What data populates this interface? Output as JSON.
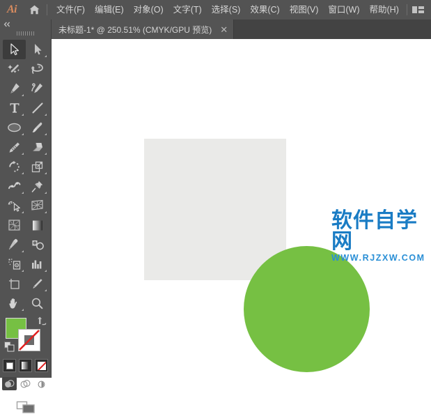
{
  "app": {
    "name": "Adobe Illustrator",
    "logo_text": "Ai"
  },
  "menubar": {
    "home_icon": "home-icon",
    "workspace_icon": "workspace-layout-icon",
    "items": [
      {
        "label": "文件(F)",
        "name": "menu-file"
      },
      {
        "label": "编辑(E)",
        "name": "menu-edit"
      },
      {
        "label": "对象(O)",
        "name": "menu-object"
      },
      {
        "label": "文字(T)",
        "name": "menu-type"
      },
      {
        "label": "选择(S)",
        "name": "menu-select"
      },
      {
        "label": "效果(C)",
        "name": "menu-effect"
      },
      {
        "label": "视图(V)",
        "name": "menu-view"
      },
      {
        "label": "窗口(W)",
        "name": "menu-window"
      },
      {
        "label": "帮助(H)",
        "name": "menu-help"
      }
    ]
  },
  "tabbar": {
    "document_title": "未标题-1* @ 250.51% (CMYK/GPU 预览)",
    "close_label": "✕"
  },
  "toolbar": {
    "collapse_icon": "double-chevron-left-icon",
    "grip_icon": "drag-grip-icon",
    "tools": [
      {
        "name": "tool-selection",
        "icon": "arrow-cursor-icon",
        "active": true,
        "flyout": false
      },
      {
        "name": "tool-direct-selection",
        "icon": "direct-arrow-icon",
        "active": false,
        "flyout": true
      },
      {
        "name": "tool-magic-wand",
        "icon": "magic-wand-icon",
        "active": false,
        "flyout": false
      },
      {
        "name": "tool-lasso",
        "icon": "lasso-icon",
        "active": false,
        "flyout": false
      },
      {
        "name": "tool-pen",
        "icon": "pen-icon",
        "active": false,
        "flyout": true
      },
      {
        "name": "tool-curvature",
        "icon": "curvature-icon",
        "active": false,
        "flyout": false
      },
      {
        "name": "tool-type",
        "icon": "type-t-icon",
        "active": false,
        "flyout": true
      },
      {
        "name": "tool-line-segment",
        "icon": "line-segment-icon",
        "active": false,
        "flyout": true
      },
      {
        "name": "tool-ellipse",
        "icon": "ellipse-icon",
        "active": false,
        "flyout": true
      },
      {
        "name": "tool-paintbrush",
        "icon": "paintbrush-icon",
        "active": false,
        "flyout": true
      },
      {
        "name": "tool-shaper",
        "icon": "pencil-shaper-icon",
        "active": false,
        "flyout": true
      },
      {
        "name": "tool-eraser",
        "icon": "eraser-icon",
        "active": false,
        "flyout": true
      },
      {
        "name": "tool-rotate",
        "icon": "rotate-icon",
        "active": false,
        "flyout": true
      },
      {
        "name": "tool-scale",
        "icon": "scale-icon",
        "active": false,
        "flyout": true
      },
      {
        "name": "tool-width",
        "icon": "width-warp-icon",
        "active": false,
        "flyout": true
      },
      {
        "name": "tool-free-transform",
        "icon": "pushpin-transform-icon",
        "active": false,
        "flyout": true
      },
      {
        "name": "tool-shape-builder",
        "icon": "shape-builder-icon",
        "active": false,
        "flyout": true
      },
      {
        "name": "tool-perspective-grid",
        "icon": "perspective-grid-icon",
        "active": false,
        "flyout": true
      },
      {
        "name": "tool-mesh",
        "icon": "mesh-icon",
        "active": false,
        "flyout": false
      },
      {
        "name": "tool-gradient",
        "icon": "gradient-icon",
        "active": false,
        "flyout": false
      },
      {
        "name": "tool-eyedropper",
        "icon": "eyedropper-icon",
        "active": false,
        "flyout": true
      },
      {
        "name": "tool-blend",
        "icon": "blend-icon",
        "active": false,
        "flyout": false
      },
      {
        "name": "tool-symbol-sprayer",
        "icon": "symbol-sprayer-icon",
        "active": false,
        "flyout": true
      },
      {
        "name": "tool-column-graph",
        "icon": "bar-graph-icon",
        "active": false,
        "flyout": true
      },
      {
        "name": "tool-artboard",
        "icon": "artboard-icon",
        "active": false,
        "flyout": false
      },
      {
        "name": "tool-slice",
        "icon": "slice-knife-icon",
        "active": false,
        "flyout": true
      },
      {
        "name": "tool-hand",
        "icon": "hand-icon",
        "active": false,
        "flyout": true
      },
      {
        "name": "tool-zoom",
        "icon": "magnifier-icon",
        "active": false,
        "flyout": false
      }
    ],
    "fill_color": "#76c043",
    "stroke_color": "none",
    "swap_icon": "swap-fill-stroke-icon",
    "default_icon": "default-fill-stroke-icon",
    "color_modes": [
      {
        "name": "mode-color",
        "icon": "solid-color-icon",
        "active": false
      },
      {
        "name": "mode-gradient",
        "icon": "gradient-swatch-icon",
        "active": false
      },
      {
        "name": "mode-none",
        "icon": "none-swatch-icon",
        "active": true
      }
    ],
    "draw_modes": [
      {
        "name": "draw-normal",
        "icon": "draw-normal-icon",
        "active": true
      },
      {
        "name": "draw-behind",
        "icon": "draw-behind-icon",
        "active": false
      },
      {
        "name": "draw-inside",
        "icon": "draw-inside-icon",
        "active": false
      }
    ],
    "screen_mode": {
      "name": "screen-mode",
      "icon": "screen-mode-icon"
    }
  },
  "canvas": {
    "background": "#ffffff",
    "artboard_color": "#eaeae8",
    "shape": {
      "type": "circle",
      "fill": "#76c043",
      "name": "green-circle-shape"
    }
  },
  "watermark": {
    "main": "软件自学网",
    "sub": "WWW.RJZXW.COM",
    "main_color": "#1a7cc4",
    "sub_color": "#2a8fd6"
  }
}
